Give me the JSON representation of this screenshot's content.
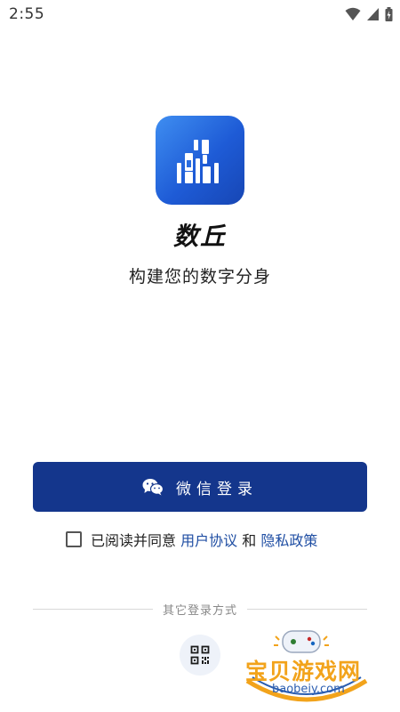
{
  "status_bar": {
    "time": "2:55"
  },
  "app": {
    "name": "数丘",
    "slogan": "构建您的数字分身"
  },
  "login": {
    "wechat_button_label": "微信登录",
    "agreement_prefix": "已阅读并同意",
    "user_agreement_link": "用户协议",
    "and_text": "和",
    "privacy_policy_link": "隐私政策",
    "other_methods_label": "其它登录方式"
  },
  "watermark": {
    "text": "宝贝游戏网",
    "url": "baobeiy.com"
  },
  "colors": {
    "primary": "#14368c",
    "link": "#1f4ea3",
    "logo_start": "#3f8ef1",
    "logo_end": "#1746b4"
  },
  "icons": {
    "wechat": "wechat-icon",
    "qr": "qr-code-icon"
  }
}
